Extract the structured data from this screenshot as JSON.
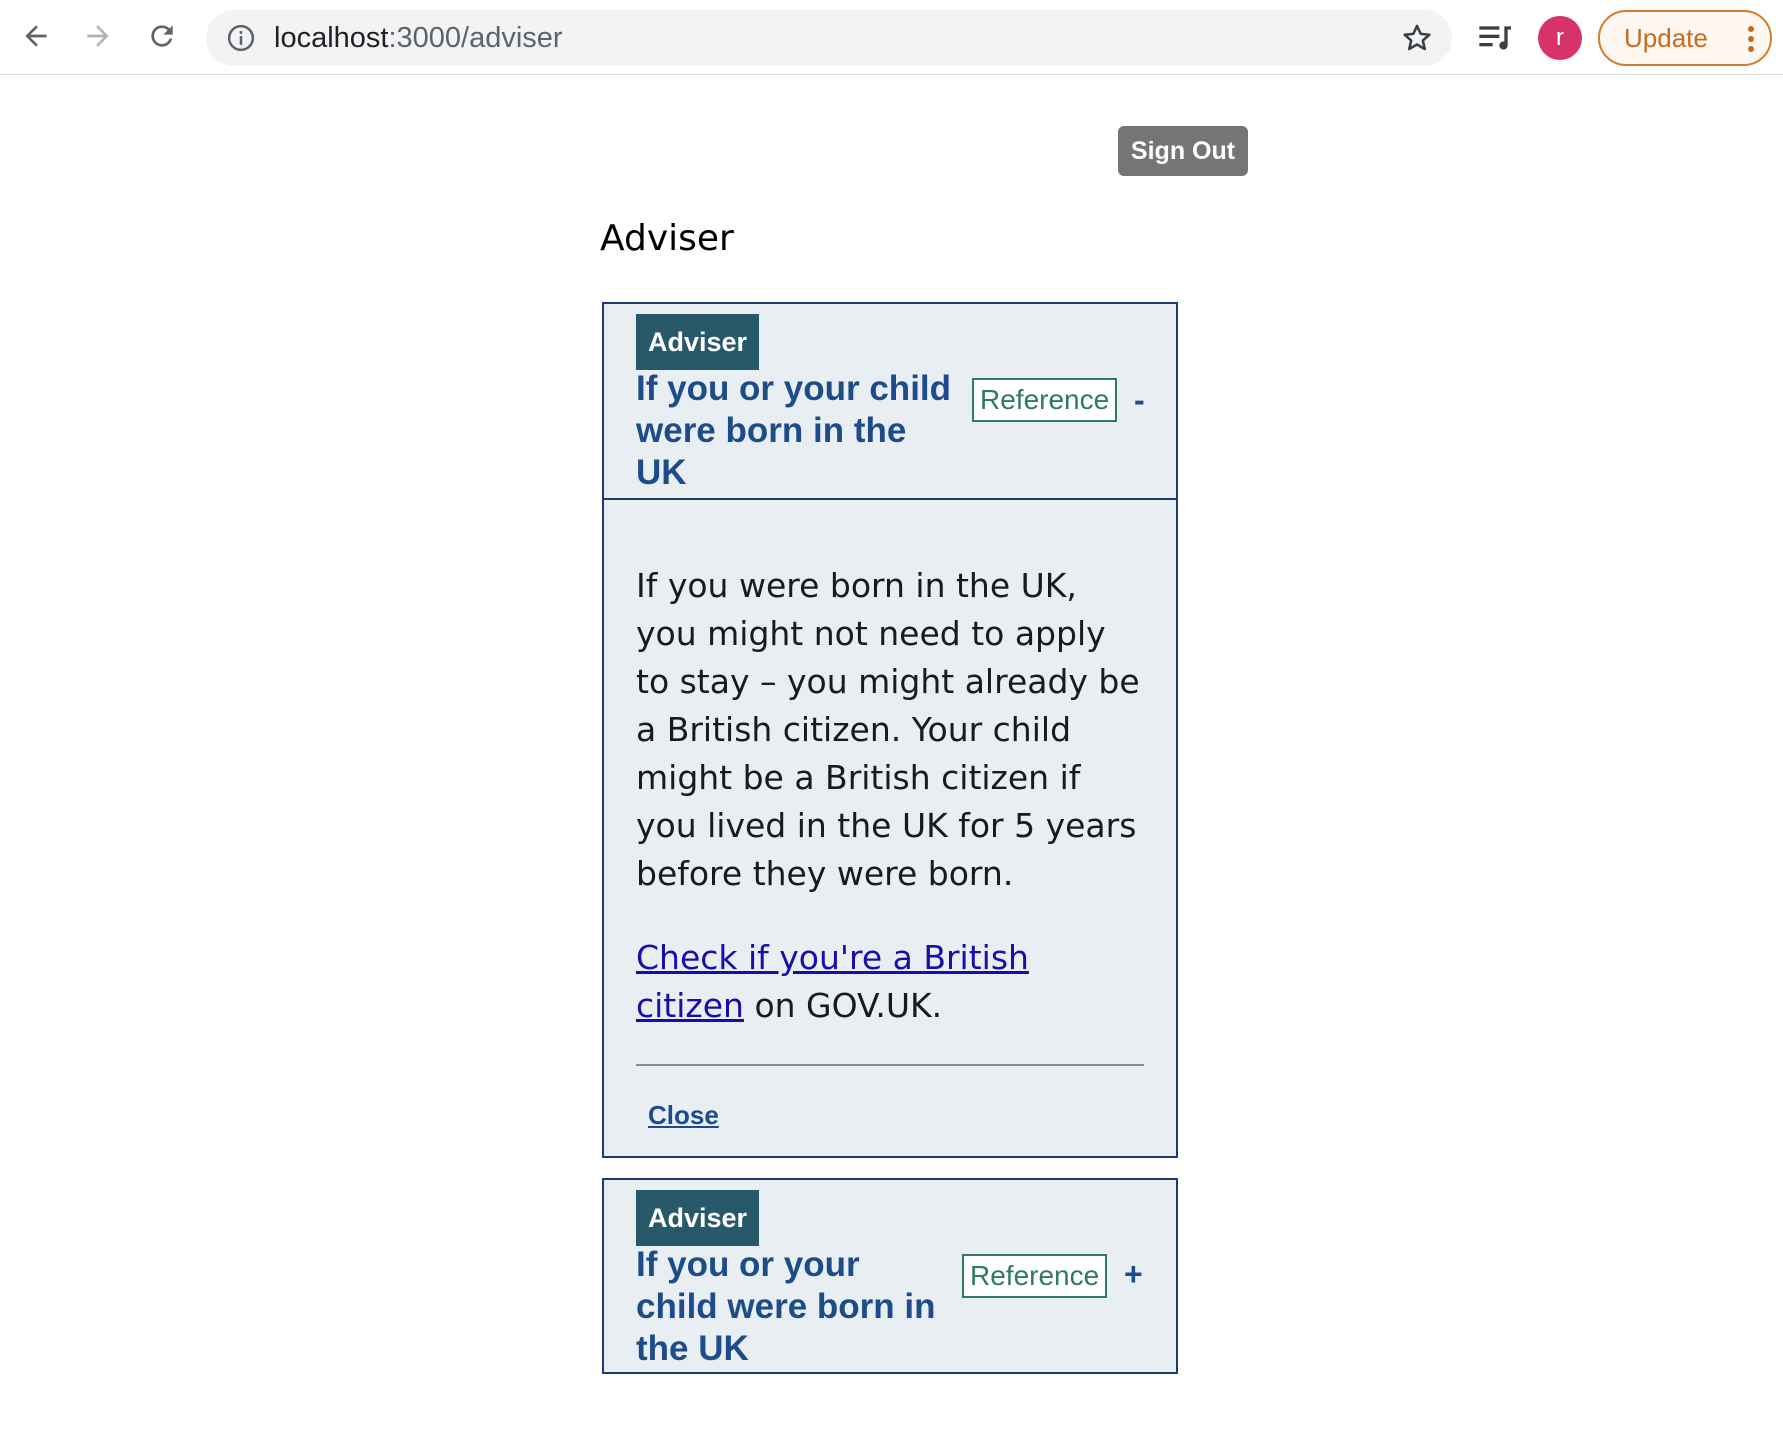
{
  "browser": {
    "url_host": "localhost",
    "url_path": ":3000/adviser",
    "profile_initial": "r",
    "update_label": "Update"
  },
  "header": {
    "signout_label": "Sign Out",
    "page_title": "Adviser"
  },
  "cards": [
    {
      "tag": "Adviser",
      "title": "If you or your child were born in the UK",
      "reference_label": "Reference",
      "toggle": "-",
      "expanded": true,
      "body_paragraph": "If you were born in the UK, you might not need to apply to stay – you might already be a British citizen. Your child might be a British citizen if you lived in the UK for 5 years before they were born.",
      "link_text": "Check if you're a British citizen",
      "link_suffix": " on GOV.UK.",
      "close_label": "Close"
    },
    {
      "tag": "Adviser",
      "title": "If you or your child were born in the UK",
      "reference_label": "Reference",
      "toggle": "+",
      "expanded": false
    }
  ],
  "colors": {
    "card_border": "#1d3b6e",
    "card_background": "#e8eef2",
    "tag_background": "#28596b",
    "title_color": "#1d4c8a",
    "reference_color": "#2d7a65",
    "signout_background": "#757575",
    "update_color": "#c86a1c",
    "avatar_color": "#d6336c"
  }
}
